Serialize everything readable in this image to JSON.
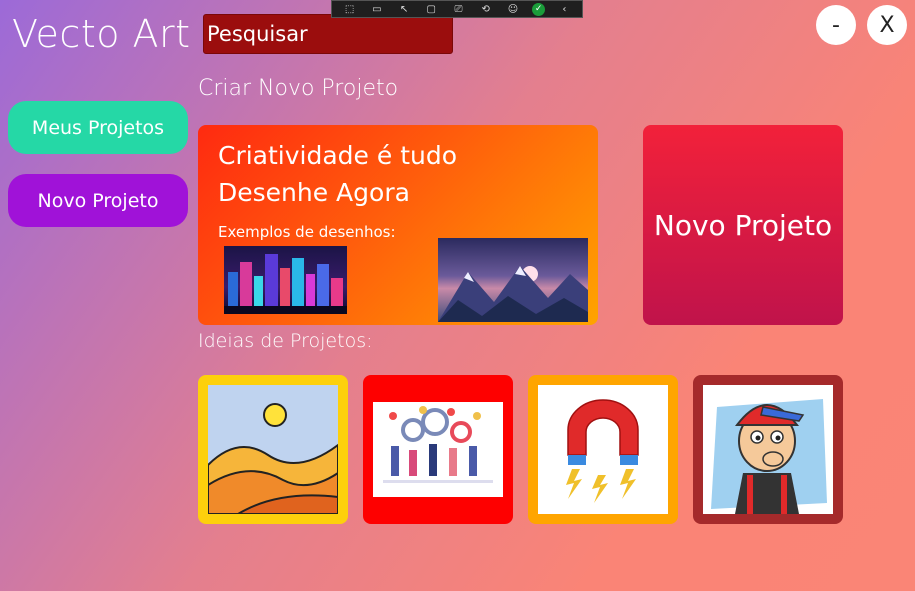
{
  "app": {
    "title": "Vecto Art"
  },
  "search": {
    "placeholder": "Pesquisar"
  },
  "window": {
    "minimize_label": "-",
    "close_label": "X"
  },
  "sidebar": {
    "items": [
      {
        "label": "Meus Projetos"
      },
      {
        "label": "Novo Projeto"
      }
    ]
  },
  "main": {
    "section_title": "Criar Novo Projeto",
    "hero": {
      "line1": "Criatividade é tudo",
      "line2": "Desenhe Agora",
      "subtitle": "Exemplos de desenhos:"
    },
    "new_project_label": "Novo Projeto",
    "ideas_title": "Ideias de Projetos:"
  },
  "colors": {
    "search_bg": "#9b0d0d",
    "nav_1": "#25d8a6",
    "nav_2": "#a012d8",
    "cta": "#e01b3f",
    "idea_1": "#fdd00c",
    "idea_2": "#fe0000",
    "idea_3": "#ffa500",
    "idea_4": "#a52a2b"
  }
}
